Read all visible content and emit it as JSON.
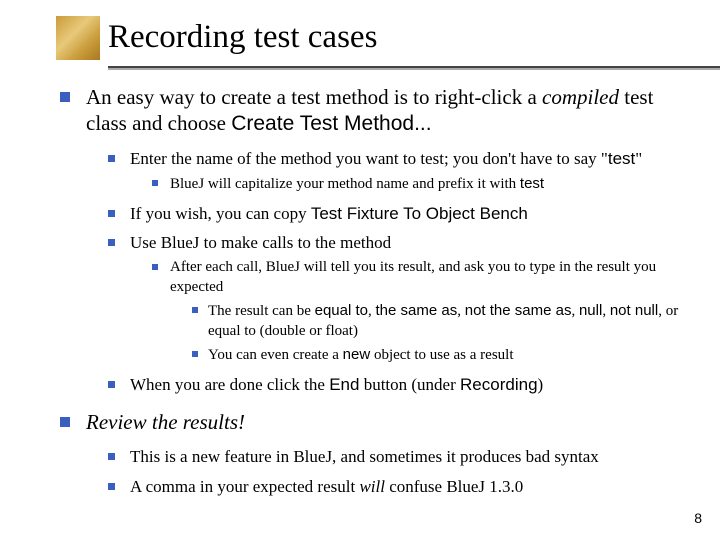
{
  "title": "Recording test cases",
  "b1a_pre": "An easy way to create a test method is to right-click a ",
  "b1a_it": "compiled",
  "b1a_mid": " test class and choose ",
  "b1a_code": "Create Test Method...",
  "b1a_sub1_pre": "Enter the name of the method you want to test; you don't have to say \"",
  "b1a_sub1_code": "test",
  "b1a_sub1_post": "\"",
  "b1a_sub1_sub1_pre": "BlueJ will capitalize your method name and prefix it with ",
  "b1a_sub1_sub1_code": "test",
  "b1a_sub2_pre": "If you wish, you can copy ",
  "b1a_sub2_code": "Test Fixture To Object Bench",
  "b1a_sub3": "Use BlueJ to make calls to the method",
  "b1a_sub3_sub1": "After each call, BlueJ will tell you its result, and ask you to type in the result you expected",
  "b1a_sub3_sub1_sub1_pre": "The result can be ",
  "b1a_sub3_sub1_sub1_c1": "equal to",
  "b1a_sub3_sub1_sub1_s1": ", ",
  "b1a_sub3_sub1_sub1_c2": "the same as",
  "b1a_sub3_sub1_sub1_s2": ", ",
  "b1a_sub3_sub1_sub1_c3": "not the same as",
  "b1a_sub3_sub1_sub1_s3": ", ",
  "b1a_sub3_sub1_sub1_c4": "null",
  "b1a_sub3_sub1_sub1_s4": ", ",
  "b1a_sub3_sub1_sub1_c5": "not null",
  "b1a_sub3_sub1_sub1_s5": ", or ",
  "b1a_sub3_sub1_sub1_c6": "equal to (double or float)",
  "b1a_sub3_sub1_sub2_pre": "You can even create a ",
  "b1a_sub3_sub1_sub2_code": "new",
  "b1a_sub3_sub1_sub2_post": " object to use as a result",
  "b1a_sub4_pre": "When you are done click the ",
  "b1a_sub4_code1": "End",
  "b1a_sub4_mid": " button (under ",
  "b1a_sub4_code2": "Recording",
  "b1a_sub4_post": ")",
  "b1b": "Review the results!",
  "b1b_sub1": "This is a new feature in BlueJ, and sometimes it produces bad syntax",
  "b1b_sub2_pre": "A comma in your expected result ",
  "b1b_sub2_it": "will",
  "b1b_sub2_post": " confuse BlueJ 1.3.0",
  "page": "8"
}
